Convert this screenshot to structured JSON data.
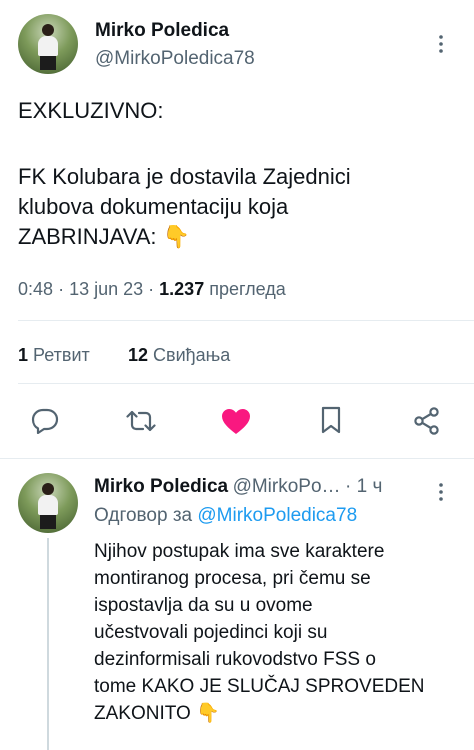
{
  "tweet": {
    "author_name": "Mirko Poledica",
    "author_handle": "@MirkoPoledica78",
    "lines": [
      "EXKLUZIVNO:",
      "FK Kolubara je dostavila Zajednici",
      "klubova dokumentaciju koja",
      "ZABRINJAVA: 👇"
    ],
    "time": "0:48",
    "date": "13 jun 23",
    "views_count": "1.237",
    "views_label": "прегледа",
    "retweets_count": "1",
    "retweets_label": "Ретвит",
    "likes_count": "12",
    "likes_label": "Свиђања",
    "liked": true
  },
  "reply": {
    "author_name": "Mirko Poledica",
    "author_handle": "@MirkoPo…",
    "time_ago": "1 ч",
    "reply_prefix": "Одговор за",
    "reply_to": "@MirkoPoledica78",
    "lines": [
      "Njihov postupak ima sve karaktere",
      "montiranog procesa, pri čemu se",
      "ispostavlja da su u ovome",
      "učestvovali pojedinci koji su",
      "dezinformisali rukovodstvo FSS o",
      "tome KAKO JE SLUČAJ SPROVEDEN",
      "ZAKONITO 👇"
    ]
  },
  "colors": {
    "like": "#f91880",
    "link": "#1d9bf0",
    "muted": "#536471"
  },
  "icons": [
    "more-icon",
    "reply-icon",
    "retweet-icon",
    "heart-icon",
    "bookmark-icon",
    "share-icon"
  ]
}
